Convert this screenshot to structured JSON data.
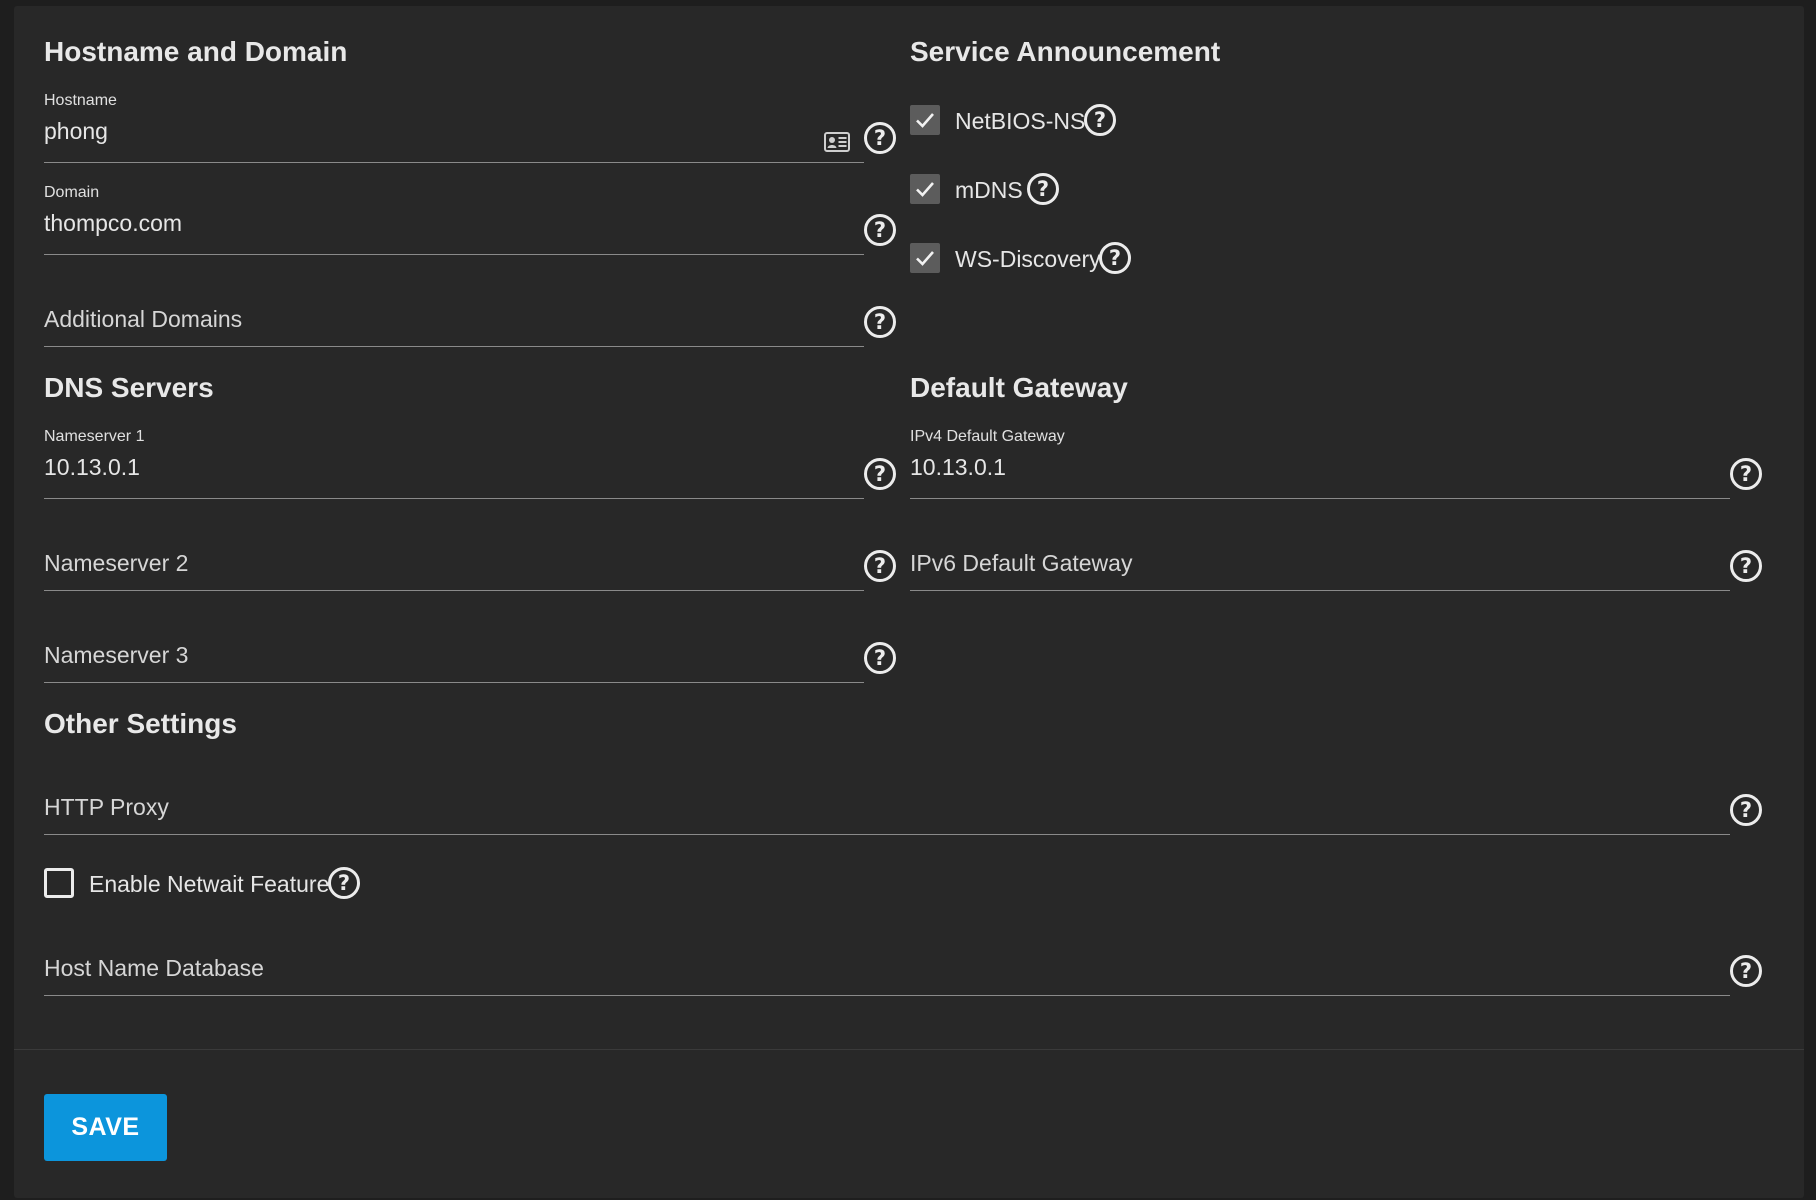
{
  "sections": {
    "hostname_domain": "Hostname and Domain",
    "service_announcement": "Service Announcement",
    "dns_servers": "DNS Servers",
    "default_gateway": "Default Gateway",
    "other_settings": "Other Settings"
  },
  "fields": {
    "hostname": {
      "label": "Hostname",
      "value": "phong"
    },
    "domain": {
      "label": "Domain",
      "value": "thompco.com"
    },
    "additional_domains": {
      "placeholder": "Additional Domains"
    },
    "nameserver1": {
      "label": "Nameserver 1",
      "value": "10.13.0.1"
    },
    "nameserver2": {
      "placeholder": "Nameserver 2"
    },
    "nameserver3": {
      "placeholder": "Nameserver 3"
    },
    "ipv4_gateway": {
      "label": "IPv4 Default Gateway",
      "value": "10.13.0.1"
    },
    "ipv6_gateway": {
      "placeholder": "IPv6 Default Gateway"
    },
    "http_proxy": {
      "placeholder": "HTTP Proxy"
    },
    "host_name_database": {
      "placeholder": "Host Name Database"
    }
  },
  "checkboxes": {
    "netbios_ns": {
      "label": "NetBIOS-NS",
      "checked": true
    },
    "mdns": {
      "label": "mDNS",
      "checked": true
    },
    "ws_discovery": {
      "label": "WS-Discovery",
      "checked": true
    },
    "netwait": {
      "label": "Enable Netwait Feature",
      "checked": false
    }
  },
  "help_glyph": "?",
  "icons": {
    "help": "help-circle-icon",
    "check": "check-icon",
    "card": "id-card-icon"
  },
  "colors": {
    "background": "#282828",
    "accent": "#0c95dc",
    "text": "#e6e6e6"
  },
  "actions": {
    "save_label": "SAVE"
  }
}
